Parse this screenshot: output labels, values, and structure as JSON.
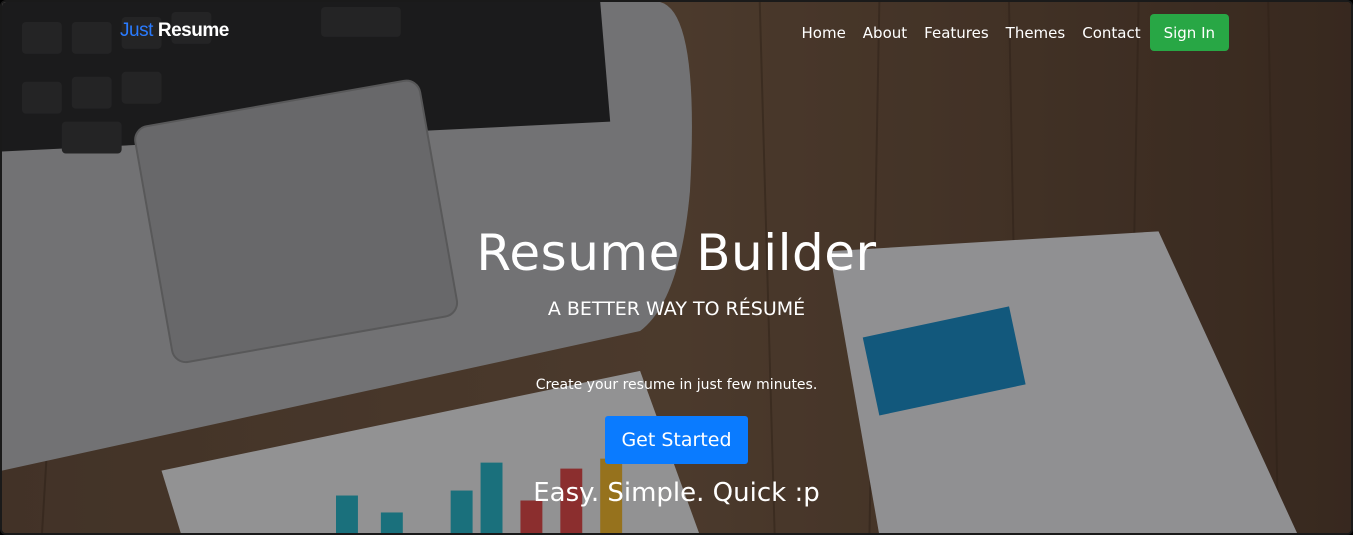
{
  "brand": {
    "part1": "Just",
    "part2": "Resume"
  },
  "nav": {
    "items": [
      {
        "label": "Home"
      },
      {
        "label": "About"
      },
      {
        "label": "Features"
      },
      {
        "label": "Themes"
      },
      {
        "label": "Contact"
      }
    ],
    "signin_label": "Sign In"
  },
  "hero": {
    "title": "Resume Builder",
    "subtitle": "A BETTER WAY TO RÉSUMÉ",
    "description": "Create your resume in just few minutes.",
    "cta_label": "Get Started",
    "tagline": "Easy. Simple. Quick :p"
  },
  "colors": {
    "brand_accent": "#2a7bff",
    "signin_bg": "#28a745",
    "cta_bg": "#0a7bff"
  },
  "background": {
    "description_icon": "desk-laptop-resume-photo"
  }
}
